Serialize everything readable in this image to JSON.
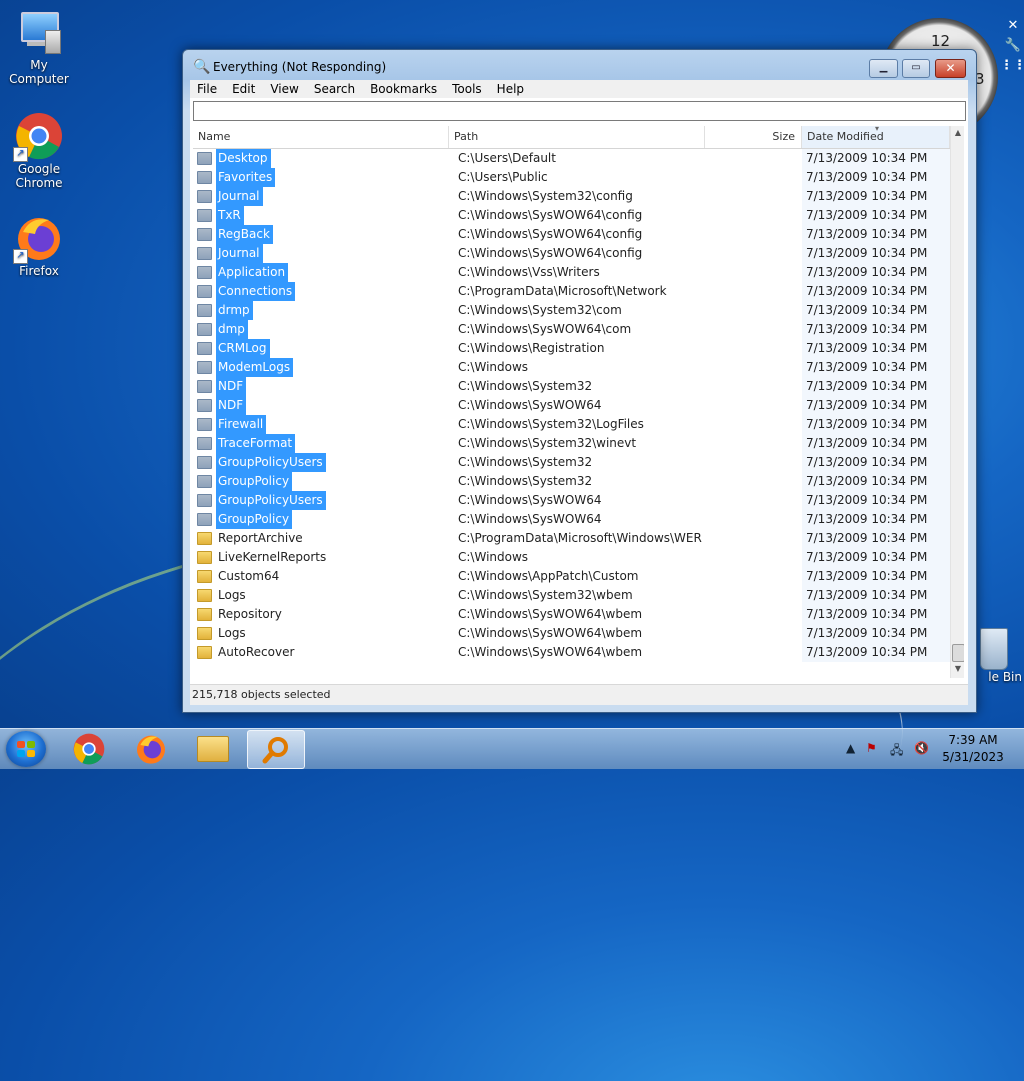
{
  "desktop": {
    "icons": [
      {
        "label": "My Computer"
      },
      {
        "label": "Google Chrome"
      },
      {
        "label": "Firefox"
      }
    ],
    "recycle_bin_partial_label": "le Bin",
    "clock_numbers": [
      "12",
      "3"
    ]
  },
  "window": {
    "title": "Everything (Not Responding)",
    "menu": [
      "File",
      "Edit",
      "View",
      "Search",
      "Bookmarks",
      "Tools",
      "Help"
    ],
    "search_value": "",
    "columns": {
      "name": "Name",
      "path": "Path",
      "size": "Size",
      "date": "Date Modified"
    },
    "rows": [
      {
        "name": "Desktop",
        "path": "C:\\Users\\Default",
        "date": "7/13/2009 10:34 PM",
        "selected": true
      },
      {
        "name": "Favorites",
        "path": "C:\\Users\\Public",
        "date": "7/13/2009 10:34 PM",
        "selected": true
      },
      {
        "name": "Journal",
        "path": "C:\\Windows\\System32\\config",
        "date": "7/13/2009 10:34 PM",
        "selected": true
      },
      {
        "name": "TxR",
        "path": "C:\\Windows\\SysWOW64\\config",
        "date": "7/13/2009 10:34 PM",
        "selected": true
      },
      {
        "name": "RegBack",
        "path": "C:\\Windows\\SysWOW64\\config",
        "date": "7/13/2009 10:34 PM",
        "selected": true
      },
      {
        "name": "Journal",
        "path": "C:\\Windows\\SysWOW64\\config",
        "date": "7/13/2009 10:34 PM",
        "selected": true
      },
      {
        "name": "Application",
        "path": "C:\\Windows\\Vss\\Writers",
        "date": "7/13/2009 10:34 PM",
        "selected": true
      },
      {
        "name": "Connections",
        "path": "C:\\ProgramData\\Microsoft\\Network",
        "date": "7/13/2009 10:34 PM",
        "selected": true
      },
      {
        "name": "drmp",
        "path": "C:\\Windows\\System32\\com",
        "date": "7/13/2009 10:34 PM",
        "selected": true
      },
      {
        "name": "dmp",
        "path": "C:\\Windows\\SysWOW64\\com",
        "date": "7/13/2009 10:34 PM",
        "selected": true
      },
      {
        "name": "CRMLog",
        "path": "C:\\Windows\\Registration",
        "date": "7/13/2009 10:34 PM",
        "selected": true
      },
      {
        "name": "ModemLogs",
        "path": "C:\\Windows",
        "date": "7/13/2009 10:34 PM",
        "selected": true
      },
      {
        "name": "NDF",
        "path": "C:\\Windows\\System32",
        "date": "7/13/2009 10:34 PM",
        "selected": true
      },
      {
        "name": "NDF",
        "path": "C:\\Windows\\SysWOW64",
        "date": "7/13/2009 10:34 PM",
        "selected": true
      },
      {
        "name": "Firewall",
        "path": "C:\\Windows\\System32\\LogFiles",
        "date": "7/13/2009 10:34 PM",
        "selected": true
      },
      {
        "name": "TraceFormat",
        "path": "C:\\Windows\\System32\\winevt",
        "date": "7/13/2009 10:34 PM",
        "selected": true
      },
      {
        "name": "GroupPolicyUsers",
        "path": "C:\\Windows\\System32",
        "date": "7/13/2009 10:34 PM",
        "selected": true
      },
      {
        "name": "GroupPolicy",
        "path": "C:\\Windows\\System32",
        "date": "7/13/2009 10:34 PM",
        "selected": true
      },
      {
        "name": "GroupPolicyUsers",
        "path": "C:\\Windows\\SysWOW64",
        "date": "7/13/2009 10:34 PM",
        "selected": true
      },
      {
        "name": "GroupPolicy",
        "path": "C:\\Windows\\SysWOW64",
        "date": "7/13/2009 10:34 PM",
        "selected": true
      },
      {
        "name": "ReportArchive",
        "path": "C:\\ProgramData\\Microsoft\\Windows\\WER",
        "date": "7/13/2009 10:34 PM",
        "selected": false
      },
      {
        "name": "LiveKernelReports",
        "path": "C:\\Windows",
        "date": "7/13/2009 10:34 PM",
        "selected": false
      },
      {
        "name": "Custom64",
        "path": "C:\\Windows\\AppPatch\\Custom",
        "date": "7/13/2009 10:34 PM",
        "selected": false
      },
      {
        "name": "Logs",
        "path": "C:\\Windows\\System32\\wbem",
        "date": "7/13/2009 10:34 PM",
        "selected": false
      },
      {
        "name": "Repository",
        "path": "C:\\Windows\\SysWOW64\\wbem",
        "date": "7/13/2009 10:34 PM",
        "selected": false
      },
      {
        "name": "Logs",
        "path": "C:\\Windows\\SysWOW64\\wbem",
        "date": "7/13/2009 10:34 PM",
        "selected": false
      },
      {
        "name": "AutoRecover",
        "path": "C:\\Windows\\SysWOW64\\wbem",
        "date": "7/13/2009 10:34 PM",
        "selected": false
      }
    ],
    "status": "215,718 objects selected"
  },
  "taskbar": {
    "pinned": [
      "start-button",
      "chrome-icon",
      "firefox-icon",
      "explorer-icon",
      "everything-icon"
    ],
    "time": "7:39 AM",
    "date": "5/31/2023"
  },
  "colors": {
    "selection": "#3399ff",
    "desktop": "#1566c4"
  }
}
